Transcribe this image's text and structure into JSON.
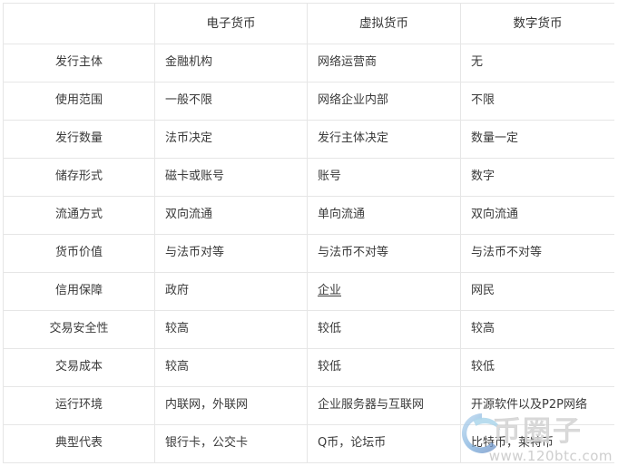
{
  "table": {
    "columns": [
      "",
      "电子货币",
      "虚拟货币",
      "数字货币"
    ],
    "rows": [
      {
        "label": "发行主体",
        "cells": [
          "金融机构",
          "网络运营商",
          "无"
        ]
      },
      {
        "label": "使用范围",
        "cells": [
          "一般不限",
          "网络企业内部",
          "不限"
        ]
      },
      {
        "label": "发行数量",
        "cells": [
          "法币决定",
          "发行主体决定",
          "数量一定"
        ]
      },
      {
        "label": "储存形式",
        "cells": [
          "磁卡或账号",
          "账号",
          "数字"
        ]
      },
      {
        "label": "流通方式",
        "cells": [
          "双向流通",
          "单向流通",
          "双向流通"
        ]
      },
      {
        "label": "货币价值",
        "cells": [
          "与法币对等",
          "与法币不对等",
          "与法币不对等"
        ]
      },
      {
        "label": "信用保障",
        "cells": [
          "政府",
          "企业",
          "网民"
        ]
      },
      {
        "label": "交易安全性",
        "cells": [
          "较高",
          "较低",
          "较高"
        ]
      },
      {
        "label": "交易成本",
        "cells": [
          "较高",
          "较低",
          "较低"
        ]
      },
      {
        "label": "运行环境",
        "cells": [
          "内联网，外联网",
          "企业服务器与互联网",
          "开源软件以及P2P网络"
        ]
      },
      {
        "label": "典型代表",
        "cells": [
          "银行卡，公交卡",
          "Q币，论坛币",
          "比特币，莱特币"
        ]
      }
    ]
  },
  "watermark": {
    "brand_cn": "币圈子",
    "url": "www.120btc.com",
    "logo_icon": "swirl-circle-logo",
    "logo_color": "#8fb8e0",
    "text_color": "#d7d7d7"
  },
  "style": {
    "border_color": "#e6e6e6",
    "text_color": "#3a3a3a",
    "background": "#ffffff"
  }
}
